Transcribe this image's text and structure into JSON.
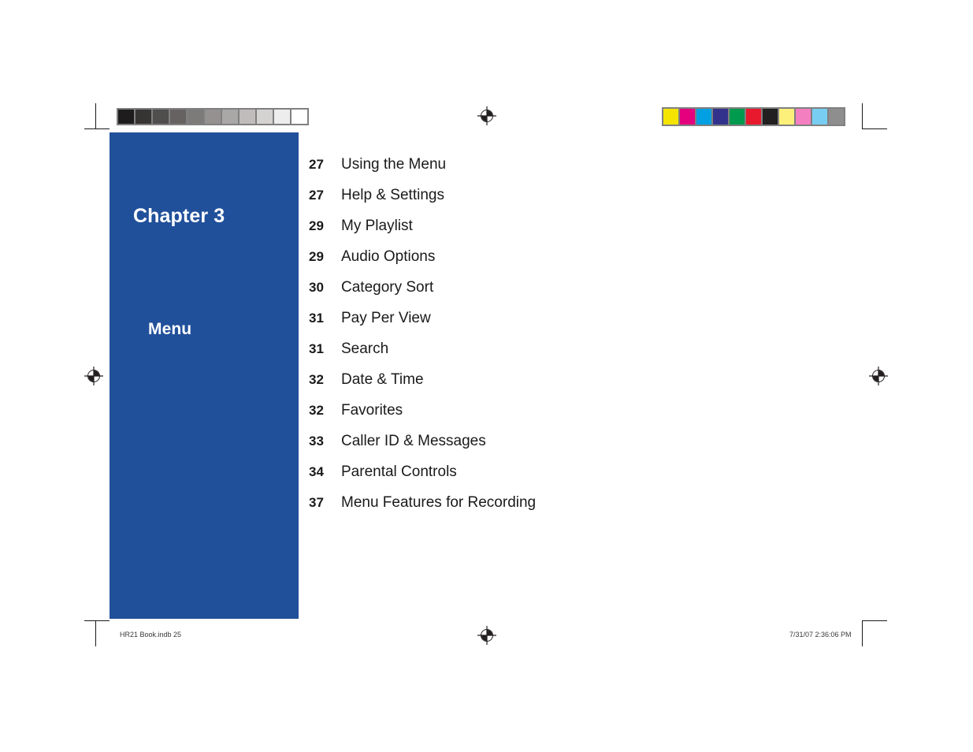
{
  "chapter": {
    "title": "Chapter 3",
    "subtitle": "Menu",
    "panel_color": "#21509B"
  },
  "toc": {
    "items": [
      {
        "page": "27",
        "label": "Using the Menu"
      },
      {
        "page": "27",
        "label": "Help & Settings"
      },
      {
        "page": "29",
        "label": "My Playlist"
      },
      {
        "page": "29",
        "label": "Audio Options"
      },
      {
        "page": "30",
        "label": "Category Sort"
      },
      {
        "page": "31",
        "label": "Pay Per View"
      },
      {
        "page": "31",
        "label": "Search"
      },
      {
        "page": "32",
        "label": "Date & Time"
      },
      {
        "page": "32",
        "label": "Favorites"
      },
      {
        "page": "33",
        "label": "Caller ID & Messages"
      },
      {
        "page": "34",
        "label": "Parental Controls"
      },
      {
        "page": "37",
        "label": "Menu Features for Recording"
      }
    ]
  },
  "footer": {
    "left": "HR21 Book.indb   25",
    "right": "7/31/07   2:36:06 PM"
  },
  "print_marks": {
    "grayscale_strip": {
      "name": "grayscale-calibration-strip",
      "swatches": [
        "#1e1c1d",
        "#373434",
        "#504d4d",
        "#666262",
        "#7d7a7a",
        "#959191",
        "#aaa7a7",
        "#c0bcbc",
        "#d5d2d2",
        "#ededed",
        "#ffffff"
      ]
    },
    "color_strip": {
      "name": "color-calibration-strip",
      "swatches": [
        "#f5e400",
        "#e5007e",
        "#00a0e2",
        "#32328c",
        "#009a4e",
        "#e8192c",
        "#221f20",
        "#fcf07a",
        "#f47fc0",
        "#78cef2",
        "#8e8e8e"
      ]
    },
    "registration_targets": [
      {
        "name": "registration-target-top-center"
      },
      {
        "name": "registration-target-left-middle"
      },
      {
        "name": "registration-target-right-middle"
      },
      {
        "name": "registration-target-bottom-center"
      }
    ]
  }
}
